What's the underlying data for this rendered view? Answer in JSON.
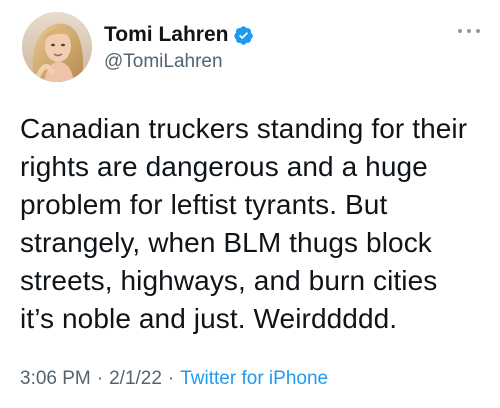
{
  "user": {
    "display_name": "Tomi Lahren",
    "handle": "@TomiLahren",
    "verified": true,
    "avatar_icon": "profile-photo"
  },
  "tweet": {
    "lines": [
      "Canadian truckers standing for their",
      "rights are dangerous and a huge",
      "problem for leftist tyrants. But",
      "strangely, when BLM thugs block",
      "streets, highways, and burn cities",
      "it’s noble and just. Weirddddd."
    ],
    "time": "3:06 PM",
    "separator": "·",
    "date": "2/1/22",
    "source": "Twitter for iPhone"
  },
  "icons": {
    "more": "more-options-icon",
    "verified": "verified-badge-icon"
  },
  "colors": {
    "text": "#0f1419",
    "secondary": "#536471",
    "link": "#1d9bf0",
    "verified": "#1d9bf0"
  }
}
